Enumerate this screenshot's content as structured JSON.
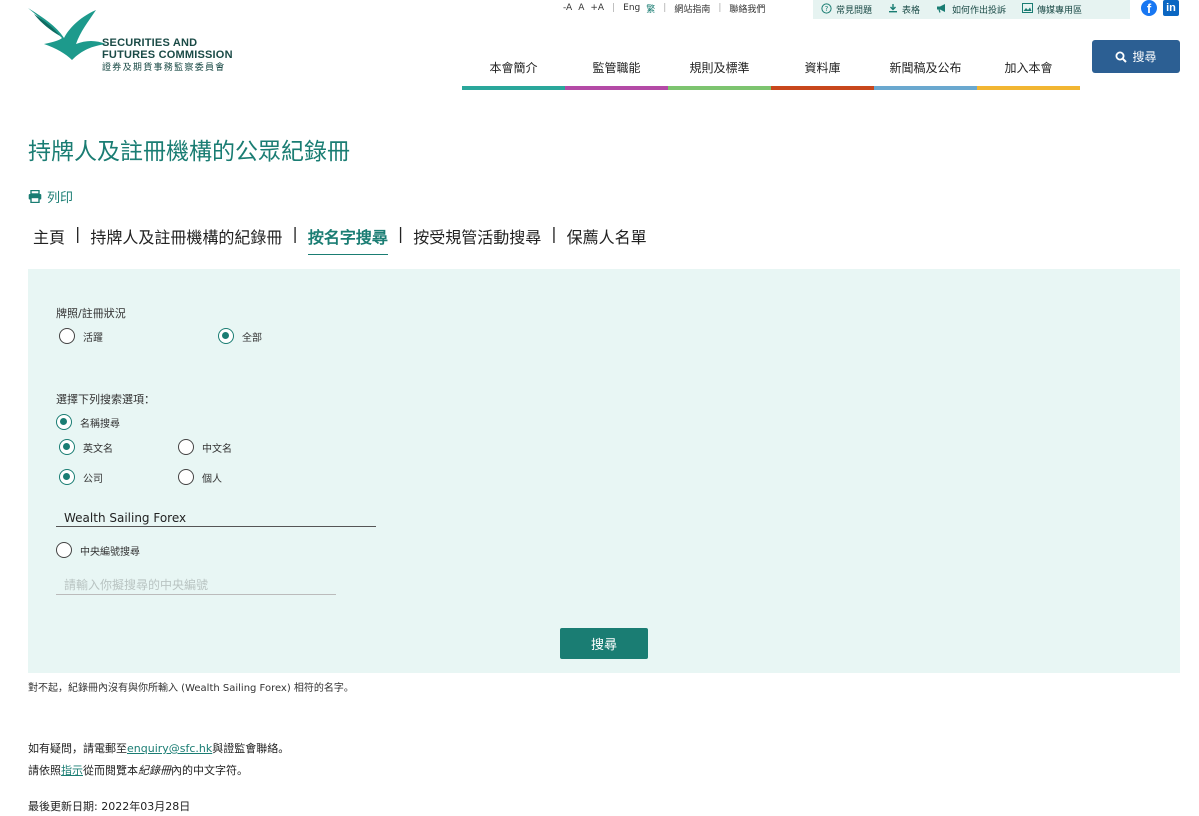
{
  "logo": {
    "line1": "SECURITIES AND",
    "line2": "FUTURES COMMISSION",
    "line3": "證券及期貨事務監察委員會"
  },
  "util_bar": {
    "font_small": "-A",
    "font_normal": "A",
    "font_large": "+A",
    "lang_eng": "Eng",
    "lang_trad": "繁",
    "sitemap": "網站指南",
    "contact": "聯絡我們"
  },
  "util_box": {
    "faq": "常見問題",
    "forms": "表格",
    "complaint": "如何作出投訴",
    "media": "傳媒專用區"
  },
  "nav": [
    {
      "label": "本會簡介",
      "color": "#2aa79b"
    },
    {
      "label": "監管職能",
      "color": "#b44aa6"
    },
    {
      "label": "規則及標準",
      "color": "#7dc46f"
    },
    {
      "label": "資料庫",
      "color": "#c8471c"
    },
    {
      "label": "新聞稿及公布",
      "color": "#6aa8cf"
    },
    {
      "label": "加入本會",
      "color": "#f2b632"
    }
  ],
  "search_button": "搜尋",
  "page_title": "持牌人及註冊機構的公眾紀錄冊",
  "print_label": "列印",
  "breadcrumb": [
    {
      "label": "主頁",
      "current": false
    },
    {
      "label": "持牌人及註冊機構的紀錄冊",
      "current": false
    },
    {
      "label": "按名字搜尋",
      "current": true
    },
    {
      "label": "按受規管活動搜尋",
      "current": false
    },
    {
      "label": "保薦人名單",
      "current": false
    }
  ],
  "form": {
    "license_status_label": "牌照/註冊狀況",
    "status_active": "活躍",
    "status_all": "全部",
    "search_options_label": "選擇下列搜索選項：",
    "name_search": "名稱搜尋",
    "english_name": "英文名",
    "chinese_name": "中文名",
    "company": "公司",
    "individual": "個人",
    "name_value": "Wealth Sailing Forex",
    "ce_search": "中央編號搜尋",
    "ce_placeholder": "請輸入你擬搜尋的中央編號",
    "submit": "搜尋"
  },
  "result_message": "對不起，紀錄冊內沒有與你所輸入 (Wealth Sailing Forex) 相符的名字。",
  "footer": {
    "enquiry_prefix": "如有疑問，請電郵至",
    "enquiry_email": "enquiry@sfc.hk",
    "enquiry_suffix": "與證監會聯絡。",
    "guide_prefix": "請依照",
    "guide_link": "指示",
    "guide_mid": "從而閱覽本",
    "guide_italic": "紀錄冊",
    "guide_suffix": "內的中文字符。",
    "last_updated": "最後更新日期: 2022年03月28日"
  }
}
